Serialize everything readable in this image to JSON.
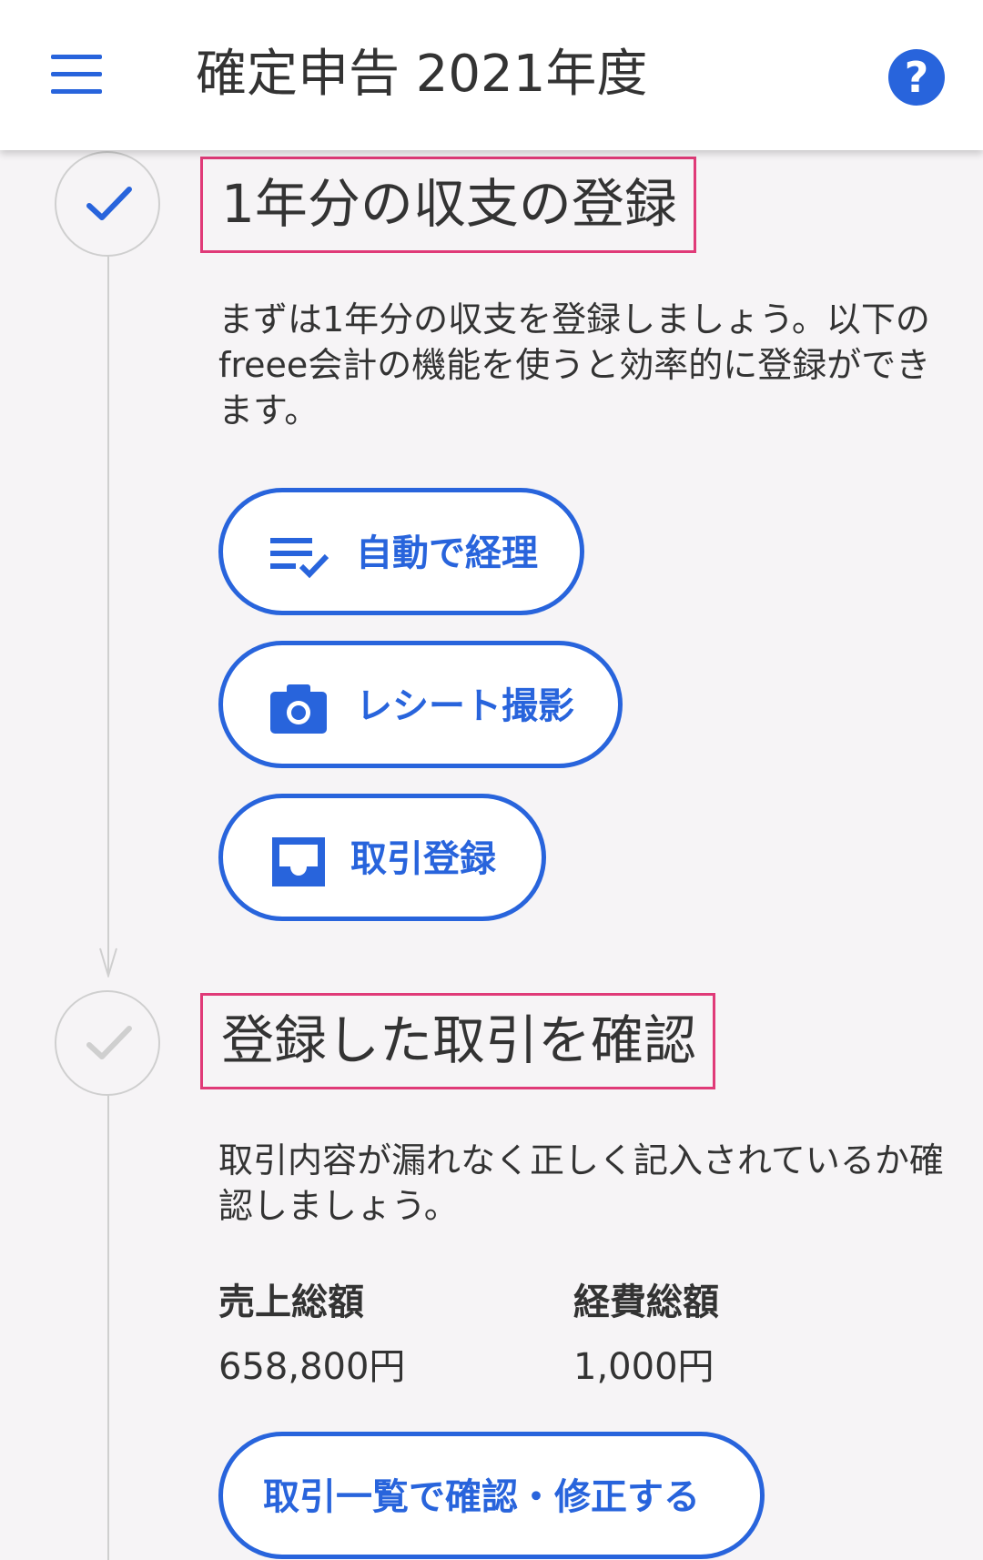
{
  "app_bar": {
    "title": "確定申告 2021年度",
    "menu_icon": "menu-icon",
    "help_icon": "help-icon",
    "help_symbol": "?"
  },
  "steps": [
    {
      "title": "1年分の収支の登録",
      "status": "completed",
      "description": "まずは1年分の収支を登録しましょう。以下のfreee会計の機能を使うと効率的に登録ができます。",
      "buttons": [
        {
          "label": "自動で経理",
          "icon": "playlist-check-icon"
        },
        {
          "label": "レシート撮影",
          "icon": "camera-icon"
        },
        {
          "label": "取引登録",
          "icon": "inbox-icon"
        }
      ]
    },
    {
      "title": "登録した取引を確認",
      "status": "pending",
      "description": "取引内容が漏れなく正しく記入されているか確認しましょう。",
      "stats": [
        {
          "label": "売上総額",
          "value": "658,800円"
        },
        {
          "label": "経費総額",
          "value": "1,000円"
        }
      ],
      "button": {
        "label": "取引一覧で確認・修正する"
      }
    }
  ],
  "colors": {
    "accent": "#2864dc",
    "highlight_border": "#e03a78",
    "background": "#f6f4f6",
    "text": "#333333",
    "timeline": "#cfcfcf"
  }
}
